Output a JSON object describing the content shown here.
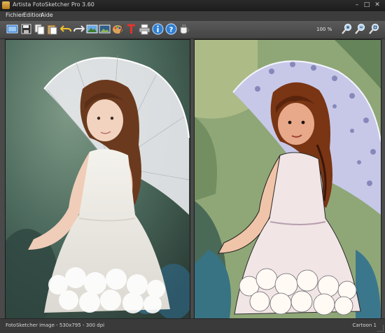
{
  "window": {
    "title": "Artista FotoSketcher Pro 3.60"
  },
  "menu": {
    "items": [
      "Fichier",
      "Edition",
      "Aide"
    ]
  },
  "toolbar": {
    "zoom": "100 %"
  },
  "status": {
    "left": "FotoSketcher image - 530x795 - 300 dpi",
    "right": "Cartoon 1"
  },
  "colors": {
    "accent": "#3d86d6",
    "chrome": "#4a4a4a"
  }
}
